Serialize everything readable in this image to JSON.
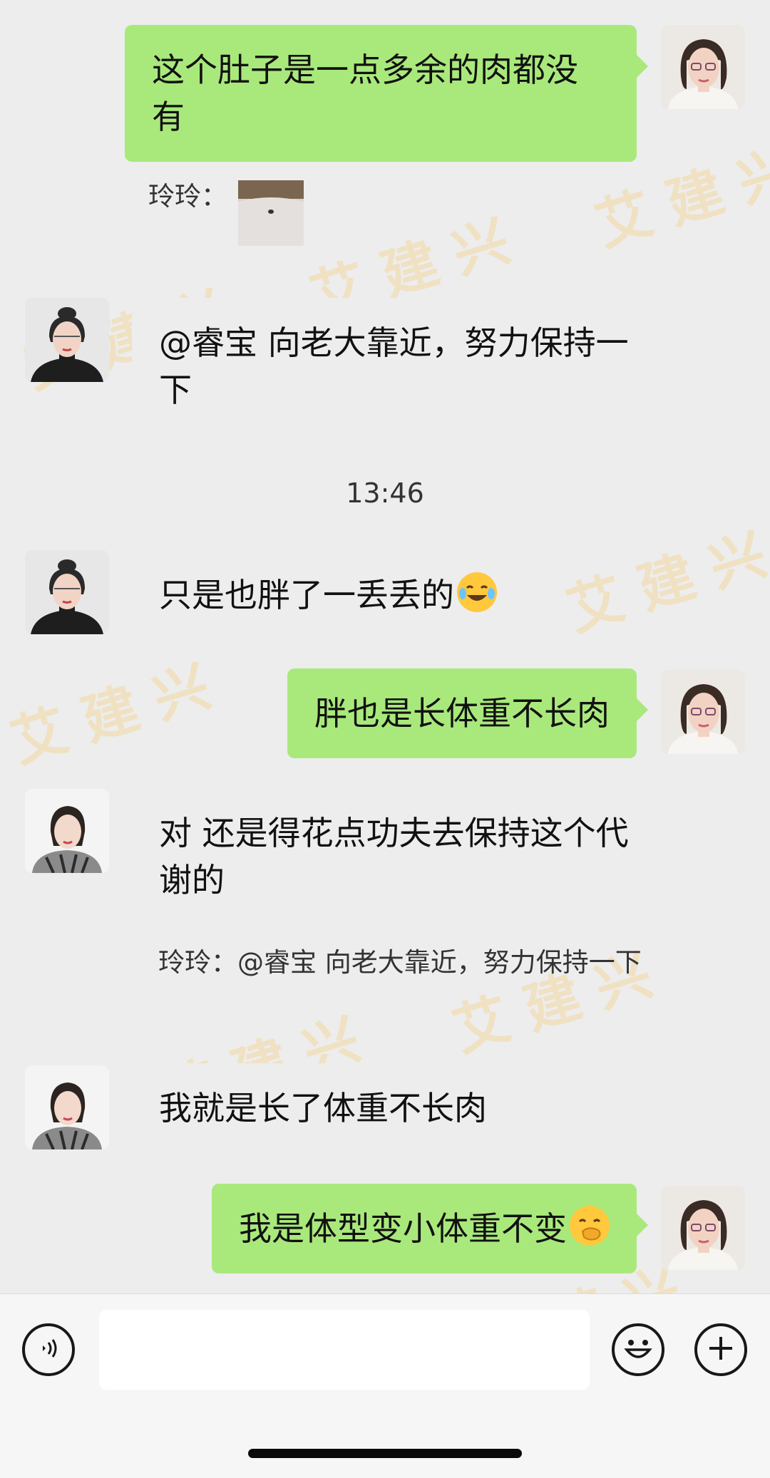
{
  "colors": {
    "background": "#ededed",
    "self_bubble": "#a9e97c",
    "watermark": "#f2ddb6",
    "bottom_bar": "#f6f6f6"
  },
  "watermark_text": "艾建兴",
  "messages": [
    {
      "sender": "self",
      "text": "这个肚子是一点多余的肉都没有"
    },
    {
      "sender": "quote",
      "label": "玲玲：",
      "attachment": "photo-thumbnail"
    },
    {
      "sender": "玲玲",
      "text": "@睿宝 向老大靠近，努力保持一下"
    },
    {
      "type": "timestamp",
      "text": "13:46"
    },
    {
      "sender": "玲玲",
      "text": "只是也胖了一丢丢的",
      "emoji": "laughing-crying-emoji"
    },
    {
      "sender": "self",
      "text": "胖也是长体重不长肉"
    },
    {
      "sender": "other",
      "text": "对 还是得花点功夫去保持这个代谢的"
    },
    {
      "sender": "quote",
      "text": "玲玲：@睿宝 向老大靠近，努力保持一下"
    },
    {
      "sender": "other",
      "text": "我就是长了体重不长肉"
    },
    {
      "sender": "self",
      "text": "我是体型变小体重不变",
      "emoji": "hand-over-mouth-emoji"
    }
  ],
  "input_bar": {
    "voice_icon": "voice-icon",
    "emoji_icon": "smile-icon",
    "plus_icon": "plus-icon",
    "input_value": ""
  }
}
